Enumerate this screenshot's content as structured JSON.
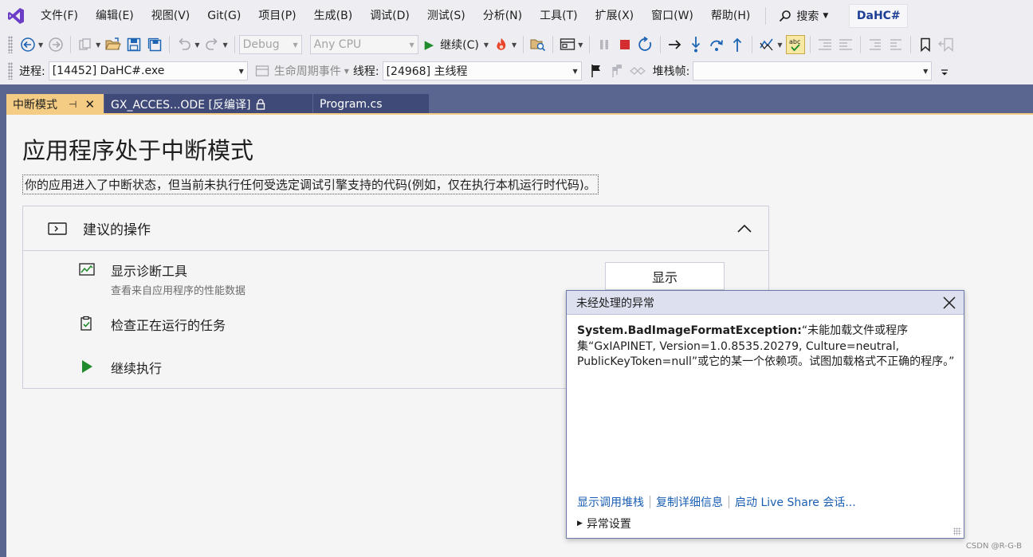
{
  "menubar": {
    "items": [
      "文件(F)",
      "编辑(E)",
      "视图(V)",
      "Git(G)",
      "项目(P)",
      "生成(B)",
      "调试(D)",
      "测试(S)",
      "分析(N)",
      "工具(T)",
      "扩展(X)",
      "窗口(W)",
      "帮助(H)"
    ],
    "search_label": "搜索",
    "solution_name": "DaHC#"
  },
  "toolbar1": {
    "configuration": "Debug",
    "platform": "Any CPU",
    "continue_label": "继续(C)"
  },
  "toolbar2": {
    "process_label": "进程:",
    "process_value": "[14452] DaHC#.exe",
    "lifecycle_label": "生命周期事件",
    "thread_label": "线程:",
    "thread_value": "[24968] 主线程",
    "stackframe_label": "堆栈帧:",
    "stackframe_value": ""
  },
  "tabs": {
    "break_mode": "中断模式",
    "decompiled": "GX_ACCES...ODE [反编译]",
    "program": "Program.cs"
  },
  "page": {
    "title": "应用程序处于中断模式",
    "description": "你的应用进入了中断状态，但当前未执行任何受选定调试引擎支持的代码(例如，仅在执行本机运行时代码)。"
  },
  "actions": {
    "title": "建议的操作",
    "diag_label": "显示诊断工具",
    "diag_sub": "查看来自应用程序的性能数据",
    "show_button": "显示",
    "tasks_label": "检查正在运行的任务",
    "continue_label": "继续执行"
  },
  "exception": {
    "title": "未经处理的异常",
    "type": "System.BadImageFormatException:",
    "message": "“未能加载文件或程序集“GxIAPINET, Version=1.0.8535.20279, Culture=neutral, PublicKeyToken=null”或它的某一个依赖项。试图加载格式不正确的程序。”",
    "link_stack": "显示调用堆栈",
    "link_copy": "复制详细信息",
    "link_liveshare": "启动 Live Share 会话...",
    "settings": "异常设置"
  },
  "watermark": "CSDN @R-G-B",
  "colors": {
    "accent_tab": "#f5cc84",
    "frame": "#5b6690",
    "link": "#1a5fb4",
    "play_green": "#1f8b2c",
    "stop_red": "#d32f2f"
  }
}
